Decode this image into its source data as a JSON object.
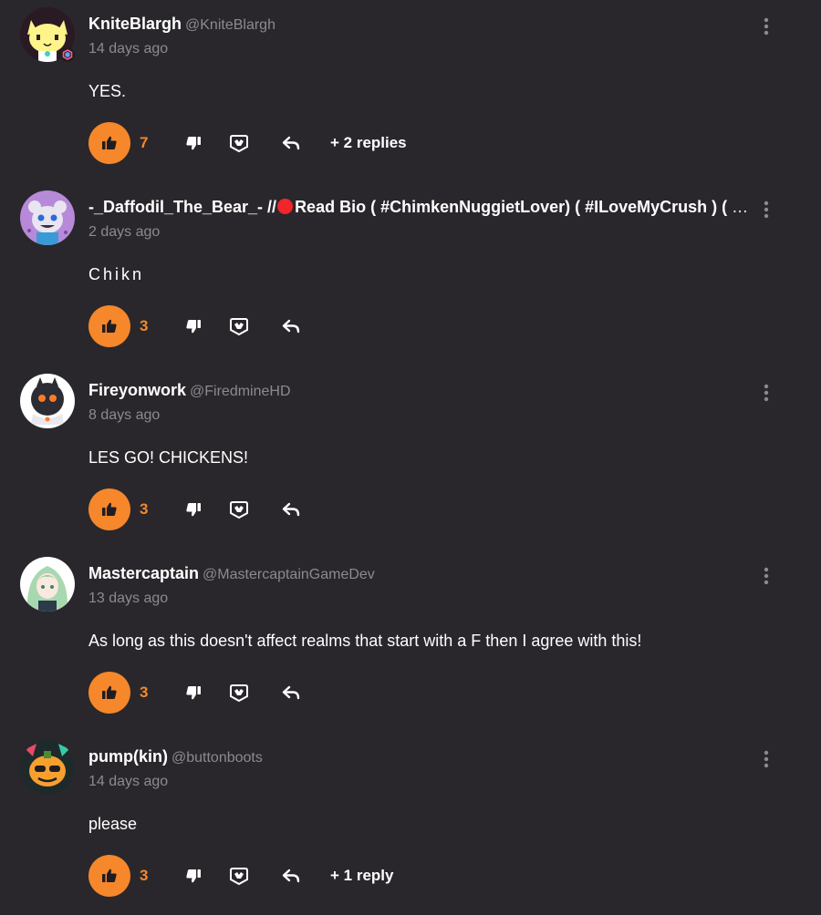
{
  "accent_color": "#f6872a",
  "background_color": "#29272b",
  "comments": [
    {
      "name": "KniteBlargh",
      "handle": "@KniteBlargh",
      "time": "14 days ago",
      "text": "YES.",
      "likes": "7",
      "replies": "+ 2 replies",
      "avatar_icon": "yellow-cat-avatar"
    },
    {
      "name_prefix": "-_Daffodil_The_Bear_- //",
      "name": "Read Bio ( #ChimkenNuggietLover) ( #ILoveMyCrush ) ( #Daffodil )",
      "time": "2 days ago",
      "text": "C h i k n",
      "likes": "3",
      "avatar_icon": "purple-bear-avatar"
    },
    {
      "name": "Fireyonwork",
      "handle": "@FiredmineHD",
      "time": "8 days ago",
      "text": "LES GO! CHICKENS!",
      "likes": "3",
      "avatar_icon": "dark-creature-avatar"
    },
    {
      "name": "Mastercaptain",
      "handle": "@MastercaptainGameDev",
      "time": "13 days ago",
      "text": "As long as this doesn't affect realms that start with a F then I agree with this!",
      "likes": "3",
      "avatar_icon": "green-hair-girl-avatar"
    },
    {
      "name": "pump(kin)",
      "handle": "@buttonboots",
      "time": "14 days ago",
      "text": "please",
      "likes": "3",
      "replies": "+ 1 reply",
      "avatar_icon": "pumpkin-avatar"
    }
  ]
}
